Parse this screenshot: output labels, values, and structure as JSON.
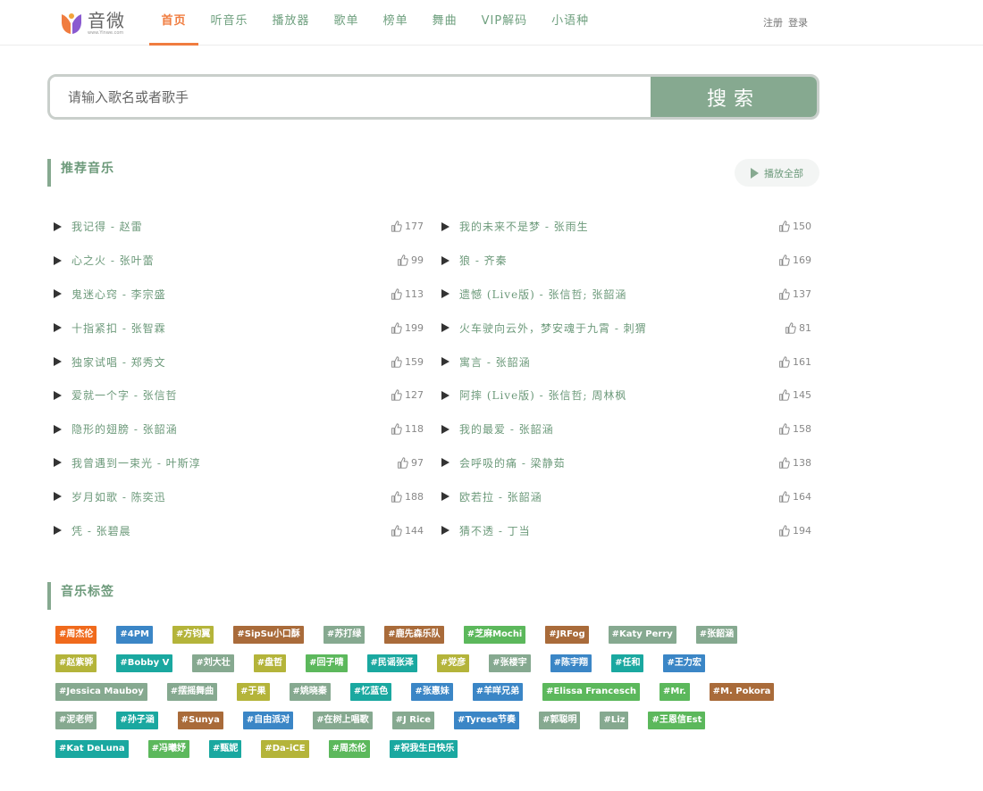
{
  "header": {
    "logo": {
      "text": "音微",
      "sub": "www.Yinwe.com",
      "colors": [
        "#f07c3f",
        "#8a5ad0",
        "#f3a43a"
      ]
    },
    "nav": [
      "首页",
      "听音乐",
      "播放器",
      "歌单",
      "榜单",
      "舞曲",
      "VIP解码",
      "小语种"
    ],
    "active_index": 0,
    "register": "注册",
    "login": "登录"
  },
  "search": {
    "placeholder": "请输入歌名或者歌手",
    "button": "搜索"
  },
  "recommend": {
    "title": "推荐音乐",
    "play_all": "播放全部",
    "songs": [
      {
        "title": "我记得 - 赵雷",
        "likes": "177"
      },
      {
        "title": "我的未来不是梦 - 张雨生",
        "likes": "150"
      },
      {
        "title": "心之火 - 张叶蕾",
        "likes": "99"
      },
      {
        "title": "狼 - 齐秦",
        "likes": "169"
      },
      {
        "title": "鬼迷心窍 - 李宗盛",
        "likes": "113"
      },
      {
        "title": "遗憾 (Live版) - 张信哲; 张韶涵",
        "likes": "137"
      },
      {
        "title": "十指紧扣 - 张智霖",
        "likes": "199"
      },
      {
        "title": "火车驶向云外，梦安魂于九霄 - 刺猬",
        "likes": "81"
      },
      {
        "title": "独家试唱 - 郑秀文",
        "likes": "159"
      },
      {
        "title": "寓言 - 张韶涵",
        "likes": "161"
      },
      {
        "title": "爱就一个字 - 张信哲",
        "likes": "127"
      },
      {
        "title": "阿摔 (Live版) - 张信哲; 周林枫",
        "likes": "145"
      },
      {
        "title": "隐形的翅膀 - 张韶涵",
        "likes": "118"
      },
      {
        "title": "我的最爱 - 张韶涵",
        "likes": "158"
      },
      {
        "title": "我曾遇到一束光 - 叶斯淳",
        "likes": "97"
      },
      {
        "title": "会呼吸的痛 - 梁静茹",
        "likes": "138"
      },
      {
        "title": "岁月如歌 - 陈奕迅",
        "likes": "188"
      },
      {
        "title": "欧若拉 - 张韶涵",
        "likes": "164"
      },
      {
        "title": "凭 - 张碧晨",
        "likes": "144"
      },
      {
        "title": "猜不透 - 丁当",
        "likes": "194"
      }
    ]
  },
  "tags_section": {
    "title": "音乐标签",
    "tags": [
      {
        "label": "#周杰伦",
        "color": "#f06a1c"
      },
      {
        "label": "#4PM",
        "color": "#3b86c6"
      },
      {
        "label": "#方钧翼",
        "color": "#b4b43a"
      },
      {
        "label": "#SipSu小口酥",
        "color": "#a96b3a"
      },
      {
        "label": "#苏打绿",
        "color": "#86a990"
      },
      {
        "label": "#鹿先森乐队",
        "color": "#a96b3a"
      },
      {
        "label": "#芝麻Mochi",
        "color": "#5cb85c"
      },
      {
        "label": "#JRFog",
        "color": "#a96b3a"
      },
      {
        "label": "#Katy Perry",
        "color": "#86a990"
      },
      {
        "label": "#张韶涵",
        "color": "#86a990"
      },
      {
        "label": "#赵紫骅",
        "color": "#b4b43a"
      },
      {
        "label": "#Bobby V",
        "color": "#1aa8a0"
      },
      {
        "label": "#刘大壮",
        "color": "#86a990"
      },
      {
        "label": "#盘哲",
        "color": "#b4b43a"
      },
      {
        "label": "#回子晴",
        "color": "#5cb85c"
      },
      {
        "label": "#民谣张泽",
        "color": "#1aa8a0"
      },
      {
        "label": "#党彦",
        "color": "#b4b43a"
      },
      {
        "label": "#张楼宇",
        "color": "#86a990"
      },
      {
        "label": "#陈宇翔",
        "color": "#3b86c6"
      },
      {
        "label": "#任和",
        "color": "#1aa8a0"
      },
      {
        "label": "#王力宏",
        "color": "#3b86c6"
      },
      {
        "label": "#Jessica Mauboy",
        "color": "#86a990"
      },
      {
        "label": "#摆摇舞曲",
        "color": "#86a990"
      },
      {
        "label": "#于果",
        "color": "#b4b43a"
      },
      {
        "label": "#姚晓秦",
        "color": "#86a990"
      },
      {
        "label": "#忆蓝色",
        "color": "#1aa8a0"
      },
      {
        "label": "#张惠妹",
        "color": "#3b86c6"
      },
      {
        "label": "#羊咩兄弟",
        "color": "#3b86c6"
      },
      {
        "label": "#Elissa Francesch",
        "color": "#5cb85c"
      },
      {
        "label": "#Mr.",
        "color": "#5cb85c"
      },
      {
        "label": "#M. Pokora",
        "color": "#a96b3a"
      },
      {
        "label": "#泥老师",
        "color": "#86a990"
      },
      {
        "label": "#孙子涵",
        "color": "#1aa8a0"
      },
      {
        "label": "#Sunya",
        "color": "#a96b3a"
      },
      {
        "label": "#自由派对",
        "color": "#3b86c6"
      },
      {
        "label": "#在树上唱歌",
        "color": "#86a990"
      },
      {
        "label": "#J Rice",
        "color": "#86a990"
      },
      {
        "label": "#Tyrese节奏",
        "color": "#3b86c6"
      },
      {
        "label": "#郭聪明",
        "color": "#86a990"
      },
      {
        "label": "#Liz",
        "color": "#86a990"
      },
      {
        "label": "#王恩信Est",
        "color": "#5cb85c"
      },
      {
        "label": "#Kat DeLuna",
        "color": "#1aa8a0"
      },
      {
        "label": "#冯曦妤",
        "color": "#5cb85c"
      },
      {
        "label": "#甄妮",
        "color": "#1aa8a0"
      },
      {
        "label": "#Da-iCE",
        "color": "#b4b43a"
      },
      {
        "label": "#周杰伦",
        "color": "#5cb85c"
      },
      {
        "label": "#祝我生日快乐",
        "color": "#1aa8a0"
      }
    ]
  }
}
